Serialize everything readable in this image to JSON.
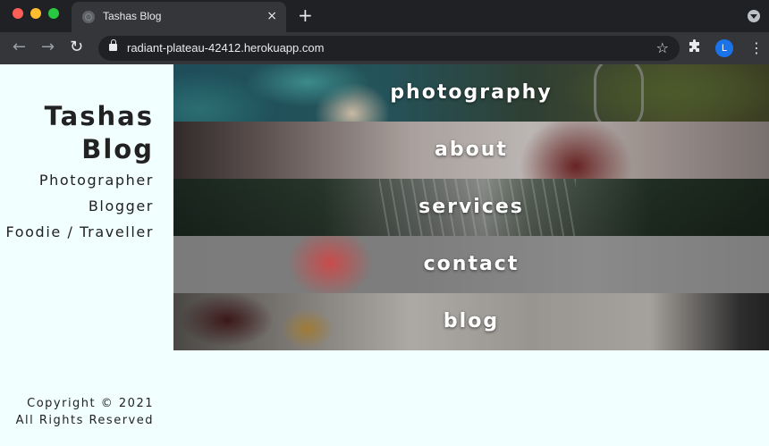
{
  "browser": {
    "tab_title": "Tashas Blog",
    "tab_close": "×",
    "new_tab": "+",
    "url": "radiant-plateau-42412.herokuapp.com",
    "profile_initial": "L",
    "icons": {
      "back": "←",
      "forward": "→",
      "reload": "↻",
      "star": "☆",
      "kebab": "⋮"
    }
  },
  "site": {
    "title_line1": "Tashas",
    "title_line2": "Blog",
    "taglines": [
      "Photographer",
      "Blogger",
      "Foodie / Traveller"
    ],
    "copyright_line1": "Copyright © 2021",
    "copyright_line2": "All Rights Reserved",
    "background_color": "#f1fffe"
  },
  "menu": {
    "items": [
      {
        "label": "photography"
      },
      {
        "label": "about"
      },
      {
        "label": "services"
      },
      {
        "label": "contact"
      },
      {
        "label": "blog"
      }
    ]
  }
}
